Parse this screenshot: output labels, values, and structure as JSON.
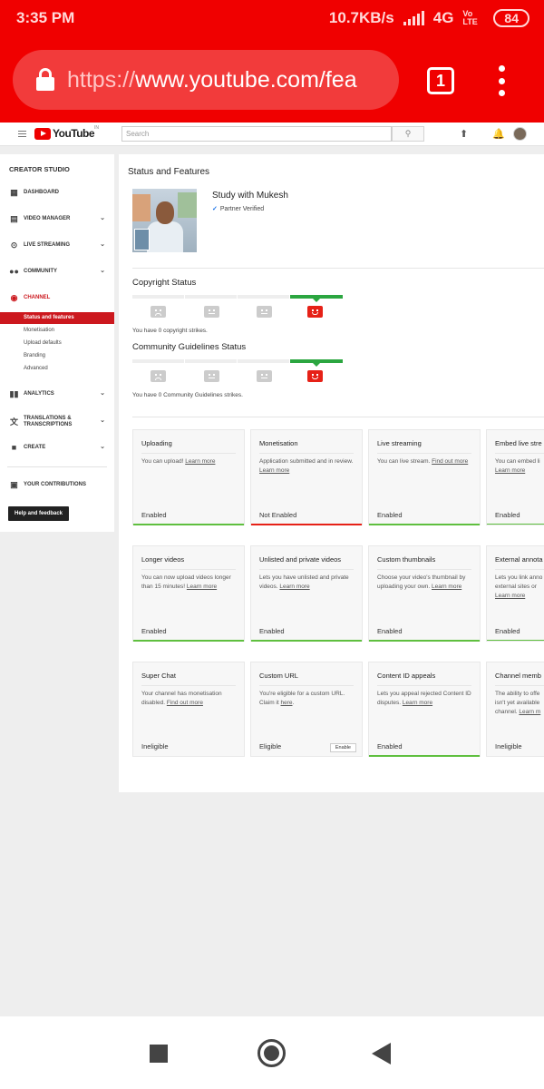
{
  "status_bar": {
    "time": "3:35 PM",
    "speed": "10.7KB/s",
    "network": "4G",
    "volte": "Vo LTE",
    "battery": "84"
  },
  "browser": {
    "url_proto": "https://",
    "url_rest": "www.youtube.com/fea",
    "tab_count": "1"
  },
  "youtube_header": {
    "logo": "YouTube",
    "country": "IN",
    "search_placeholder": "Search"
  },
  "sidebar": {
    "title": "CREATOR STUDIO",
    "items": {
      "dashboard": "DASHBOARD",
      "video_manager": "VIDEO MANAGER",
      "live_streaming": "LIVE STREAMING",
      "community": "COMMUNITY",
      "channel": "CHANNEL",
      "analytics": "ANALYTICS",
      "translations": "TRANSLATIONS & TRANSCRIPTIONS",
      "create": "CREATE",
      "contributions": "YOUR CONTRIBUTIONS"
    },
    "sub": {
      "status": "Status and features",
      "monetisation": "Monetisation",
      "upload_defaults": "Upload defaults",
      "branding": "Branding",
      "advanced": "Advanced"
    },
    "help_button": "Help and feedback"
  },
  "main": {
    "title": "Status and Features",
    "channel_name": "Study with Mukesh",
    "partner": "Partner Verified",
    "copyright_title": "Copyright Status",
    "copyright_text": "You have 0 copyright strikes.",
    "community_title": "Community Guidelines Status",
    "community_text": "You have 0 Community Guidelines strikes.",
    "cards": [
      {
        "title": "Uploading",
        "desc": "You can upload! ",
        "link": "Learn more",
        "status": "Enabled"
      },
      {
        "title": "Monetisation",
        "desc": "Application submitted and in review. ",
        "link": "Learn more",
        "status": "Not Enabled"
      },
      {
        "title": "Live streaming",
        "desc": "You can live stream. ",
        "link": "Find out more",
        "status": "Enabled"
      },
      {
        "title": "Embed live stre",
        "desc": "You can embed li",
        "link": "Learn more",
        "status": "Enabled"
      },
      {
        "title": "Longer videos",
        "desc": "You can now upload videos longer than 15 minutes! ",
        "link": "Learn more",
        "status": "Enabled"
      },
      {
        "title": "Unlisted and private videos",
        "desc": "Lets you have unlisted and private videos. ",
        "link": "Learn more",
        "status": "Enabled"
      },
      {
        "title": "Custom thumbnails",
        "desc": "Choose your video's thumbnail by uploading your own. ",
        "link": "Learn more",
        "status": "Enabled"
      },
      {
        "title": "External annota",
        "desc": "Lets you link anno external sites or ",
        "link": "Learn more",
        "status": "Enabled"
      },
      {
        "title": "Super Chat",
        "desc": "Your channel has monetisation disabled. ",
        "link": "Find out more",
        "status": "Ineligible"
      },
      {
        "title": "Custom URL",
        "desc": "You're eligible for a custom URL. Claim it ",
        "link": "here",
        "status": "Eligible",
        "button": "Enable"
      },
      {
        "title": "Content ID appeals",
        "desc": "Lets you appeal rejected Content ID disputes. ",
        "link": "Learn more",
        "status": "Enabled"
      },
      {
        "title": "Channel memb",
        "desc": "The ability to offe isn't yet available channel. ",
        "link": "Learn m",
        "status": "Ineligible"
      }
    ]
  },
  "colors": {
    "browser_red": "#f00000",
    "youtube_red": "#cc181e",
    "enabled_green": "#5fbf3f",
    "not_enabled_red": "#e62117"
  }
}
